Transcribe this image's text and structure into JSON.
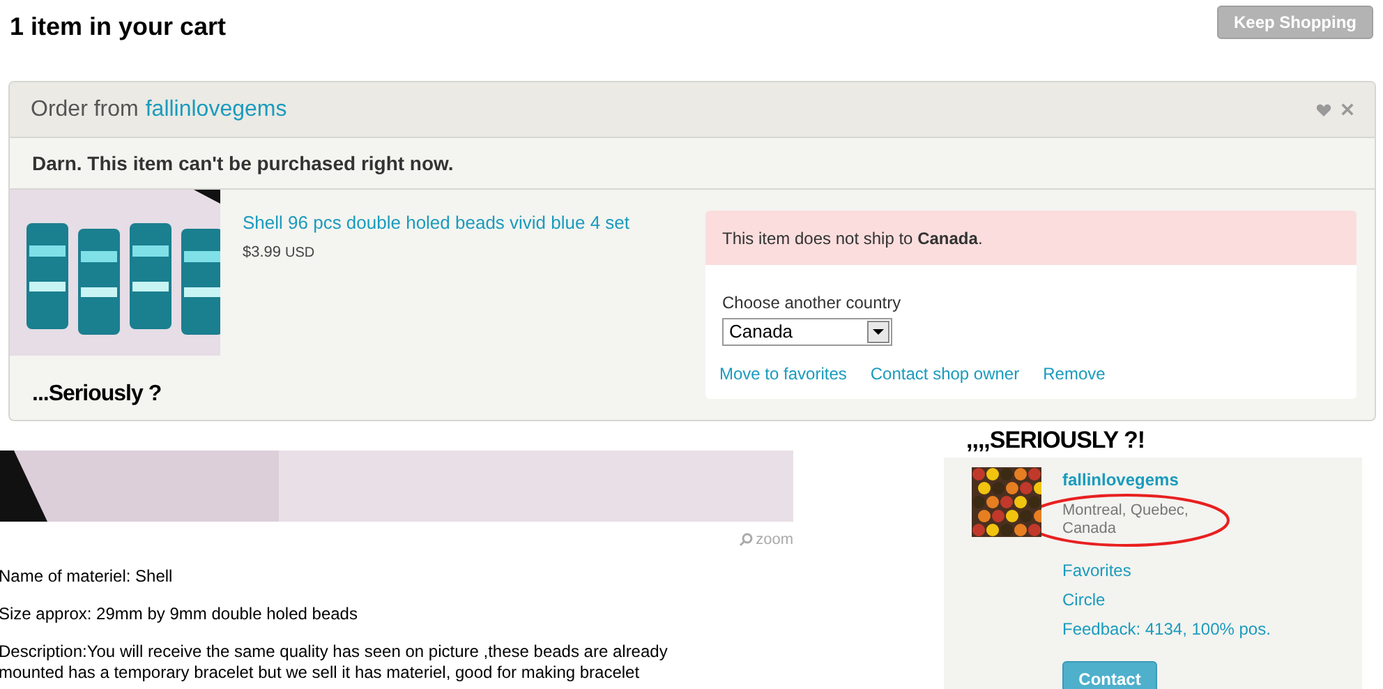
{
  "header": {
    "title": "1 item in your cart",
    "keep_shopping": "Keep Shopping"
  },
  "order": {
    "prefix": "Order from",
    "shop": "fallinlovegems",
    "notice": "Darn. This item can't be purchased right now.",
    "item": {
      "title": "Shell 96 pcs double holed beads vivid blue 4 set",
      "price": "$3.99",
      "currency": "USD"
    },
    "alert": "This item does not ship to **Canada**.",
    "country_label": "Choose another country",
    "country": "Canada",
    "actions": [
      "Move to favorites",
      "Contact shop owner",
      "Remove"
    ],
    "annotation": "...Seriously ?"
  },
  "listing": {
    "zoom": "zoom",
    "description": [
      "Name of materiel: Shell",
      "Size approx: 29mm by 9mm double holed beads",
      "Description:You will receive the same quality has seen on picture ,these beads are already mounted has a temporary bracelet but we sell it has materiel, good for making bracelet"
    ]
  },
  "shop_card": {
    "annotation": ",,,,SERIOUSLY ?!",
    "name": "fallinlovegems",
    "location": "Montreal, Quebec, Canada",
    "links": [
      "Favorites",
      "Circle",
      "Feedback: 4134, 100% pos."
    ],
    "contact": "Contact"
  }
}
